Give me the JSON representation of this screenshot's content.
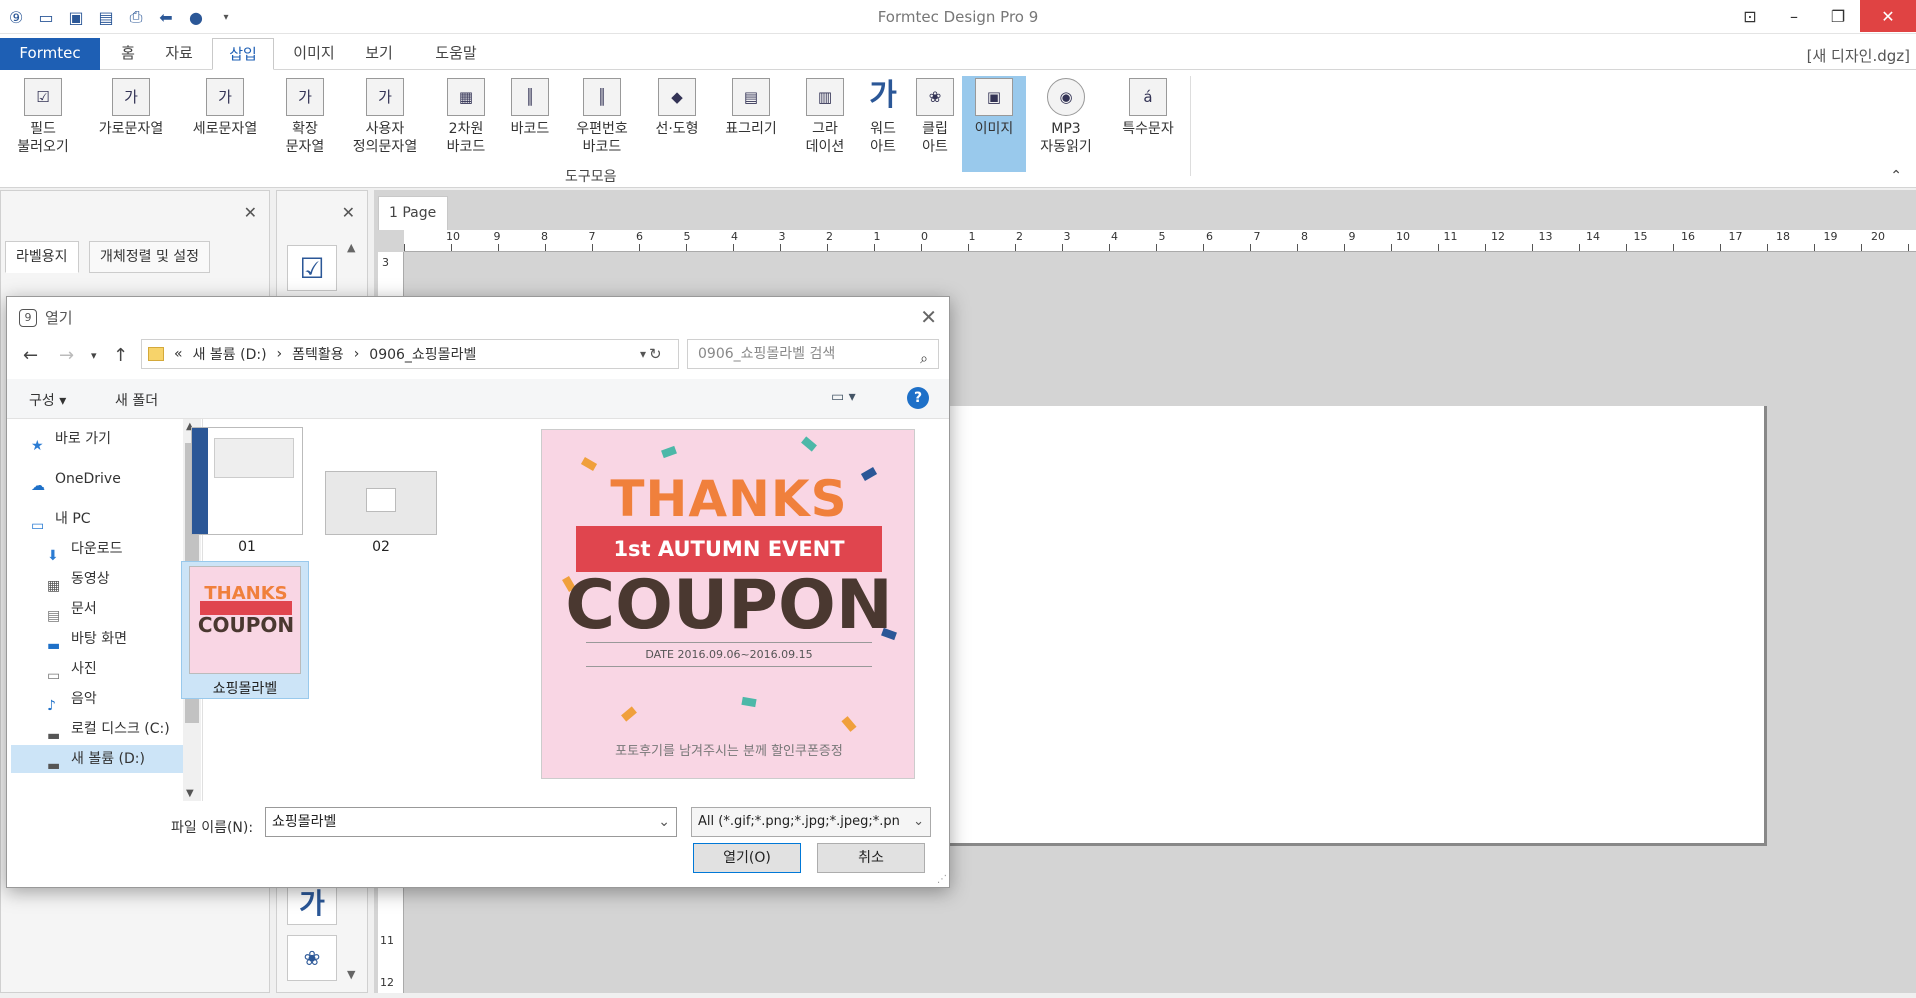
{
  "app": {
    "title": "Formtec Design Pro 9",
    "document": "[새 디자인.dgz]"
  },
  "menu_tabs": [
    {
      "label": "Formtec"
    },
    {
      "label": "홈"
    },
    {
      "label": "자료"
    },
    {
      "label": "삽입"
    },
    {
      "label": "이미지"
    },
    {
      "label": "보기"
    },
    {
      "label": "도움말"
    }
  ],
  "ribbon": {
    "items": [
      {
        "label1": "필드",
        "label2": "불러오기"
      },
      {
        "label1": "가로문자열",
        "label2": ""
      },
      {
        "label1": "세로문자열",
        "label2": ""
      },
      {
        "label1": "확장",
        "label2": "문자열"
      },
      {
        "label1": "사용자",
        "label2": "정의문자열"
      },
      {
        "label1": "2차원",
        "label2": "바코드"
      },
      {
        "label1": "바코드",
        "label2": ""
      },
      {
        "label1": "우편번호",
        "label2": "바코드"
      },
      {
        "label1": "선·도형",
        "label2": ""
      },
      {
        "label1": "표그리기",
        "label2": ""
      },
      {
        "label1": "그라",
        "label2": "데이션"
      },
      {
        "label1": "워드",
        "label2": "아트"
      },
      {
        "label1": "클립",
        "label2": "아트"
      },
      {
        "label1": "이미지",
        "label2": ""
      },
      {
        "label1": "MP3",
        "label2": "자동읽기"
      },
      {
        "label1": "특수문자",
        "label2": ""
      }
    ],
    "group_label": "도구모음"
  },
  "left_panel": {
    "tabs": [
      "라벨용지",
      "개체정렬 및 설정"
    ]
  },
  "canvas": {
    "page_tab": "1 Page"
  },
  "dialog": {
    "title": "열기",
    "breadcrumb": [
      "«",
      "새 볼륨 (D:)",
      "›",
      "폼텍활용",
      "›",
      "0906_쇼핑몰라벨"
    ],
    "search_placeholder": "0906_쇼핑몰라벨 검색",
    "organize": "구성 ▾",
    "new_folder": "새 폴더",
    "nav": [
      {
        "label": "바로 가기",
        "icon": "star-icon"
      },
      {
        "label": "OneDrive",
        "icon": "cloud-icon"
      },
      {
        "label": "내 PC",
        "icon": "pc-icon"
      },
      {
        "label": "다운로드",
        "icon": "download-icon"
      },
      {
        "label": "동영상",
        "icon": "video-icon"
      },
      {
        "label": "문서",
        "icon": "document-icon"
      },
      {
        "label": "바탕 화면",
        "icon": "desktop-icon"
      },
      {
        "label": "사진",
        "icon": "picture-icon"
      },
      {
        "label": "음악",
        "icon": "music-icon"
      },
      {
        "label": "로컬 디스크 (C:)",
        "icon": "drive-icon"
      },
      {
        "label": "새 볼륨 (D:)",
        "icon": "drive-icon"
      }
    ],
    "files": [
      {
        "name": "01"
      },
      {
        "name": "02"
      },
      {
        "name": "쇼핑몰라벨"
      }
    ],
    "preview": {
      "thanks": "THANKS",
      "banner": "1st AUTUMN EVENT",
      "coupon": "COUPON",
      "date": "DATE 2016.09.06~2016.09.15",
      "footer": "포토후기를 남겨주시는 분께 할인쿠폰증정"
    },
    "filename_label": "파일 이름(N):",
    "filename_value": "쇼핑몰라벨",
    "filetype_value": "All (*.gif;*.png;*.jpg;*.jpeg;*.pn",
    "open_button": "열기(O)",
    "cancel_button": "취소"
  }
}
